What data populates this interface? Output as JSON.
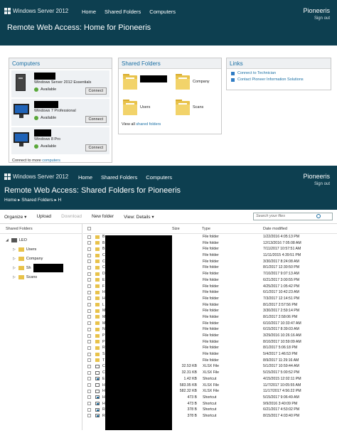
{
  "header1": {
    "logo": "Windows Server 2012",
    "nav": [
      "Home",
      "Shared Folders",
      "Computers"
    ],
    "user": "Pioneeris",
    "signout": "Sign out",
    "title": "Remote Web Access: Home for Pioneeris"
  },
  "computers": {
    "heading": "Computers",
    "items": [
      {
        "os": "Windows Server 2012 Essentials",
        "status": "Available",
        "button": "Connect"
      },
      {
        "os": "Windows 7 Professional",
        "status": "Available",
        "button": "Connect"
      },
      {
        "os": "Windows 8 Pro",
        "status": "Available",
        "button": "Connect"
      }
    ],
    "more_prefix": "Connect to more ",
    "more_link": "computers"
  },
  "shared": {
    "heading": "Shared Folders",
    "folders": [
      "Company",
      "Users",
      "Scans"
    ],
    "viewall_prefix": "View all ",
    "viewall_link": "shared folders"
  },
  "links": {
    "heading": "Links",
    "items": [
      "Connect to Technician",
      "Contact Pioneer Information Solutions"
    ]
  },
  "header2": {
    "logo": "Windows Server 2012",
    "nav": [
      "Home",
      "Shared Folders",
      "Computers"
    ],
    "user": "Pioneeris",
    "signout": "Sign out",
    "title": "Remote Web Access: Shared Folders for Pioneeris",
    "breadcrumb": [
      "Home",
      "Shared Folders",
      "H"
    ]
  },
  "toolbar": {
    "organize": "Organize ▾",
    "upload": "Upload",
    "download": "Download",
    "newfolder": "New folder",
    "view": "View: Details ▾",
    "search_placeholder": "Search your files"
  },
  "tree": {
    "header": "Shared Folders",
    "root": "LEO",
    "nodes": [
      "Users",
      "Company",
      "Sh",
      "Scans"
    ]
  },
  "columns": {
    "size": "Size",
    "type": "Type",
    "date": "Date modified"
  },
  "rows": [
    {
      "name": "B",
      "size": "",
      "type": "File folder",
      "date": "1/22/2016 4:05:13 PM",
      "kind": "folder"
    },
    {
      "name": "B",
      "size": "",
      "type": "File folder",
      "date": "12/13/2016 7:05:08 AM",
      "kind": "folder"
    },
    {
      "name": "B",
      "size": "",
      "type": "File folder",
      "date": "7/11/2017 10:57:51 AM",
      "kind": "folder"
    },
    {
      "name": "C",
      "size": "",
      "type": "File folder",
      "date": "11/11/2015 4:39:51 PM",
      "kind": "folder"
    },
    {
      "name": "C",
      "size": "",
      "type": "File folder",
      "date": "3/30/2017 8:24:08 AM",
      "kind": "folder"
    },
    {
      "name": "C",
      "size": "",
      "type": "File folder",
      "date": "8/1/2017 12:30:50 PM",
      "kind": "folder"
    },
    {
      "name": "D",
      "size": "",
      "type": "File folder",
      "date": "7/10/2017 9:07:13 AM",
      "kind": "folder"
    },
    {
      "name": "E",
      "size": "",
      "type": "File folder",
      "date": "6/21/2017 3:00:55 PM",
      "kind": "folder"
    },
    {
      "name": "F",
      "size": "",
      "type": "File folder",
      "date": "4/25/2017 1:05:42 PM",
      "kind": "folder"
    },
    {
      "name": "H",
      "size": "",
      "type": "File folder",
      "date": "6/1/2017 10:42:23 AM",
      "kind": "folder"
    },
    {
      "name": "H",
      "size": "",
      "type": "File folder",
      "date": "7/3/2017 12:14:51 PM",
      "kind": "folder"
    },
    {
      "name": "L",
      "size": "",
      "type": "File folder",
      "date": "8/1/2017 2:57:56 PM",
      "kind": "folder"
    },
    {
      "name": "M",
      "size": "",
      "type": "File folder",
      "date": "3/30/2017 2:59:14 PM",
      "kind": "folder"
    },
    {
      "name": "M",
      "size": "",
      "type": "File folder",
      "date": "8/1/2017 2:58:06 PM",
      "kind": "folder"
    },
    {
      "name": "M",
      "size": "",
      "type": "File folder",
      "date": "6/10/2017 10:33:47 AM",
      "kind": "folder"
    },
    {
      "name": "N",
      "size": "",
      "type": "File folder",
      "date": "6/15/2017 8:39:03 AM",
      "kind": "folder"
    },
    {
      "name": "P",
      "size": "",
      "type": "File folder",
      "date": "3/29/2016 10:26:16 AM",
      "kind": "folder"
    },
    {
      "name": "P",
      "size": "",
      "type": "File folder",
      "date": "8/10/2017 10:59:09 AM",
      "kind": "folder"
    },
    {
      "name": "R",
      "size": "",
      "type": "File folder",
      "date": "8/1/2017 5:06:18 PM",
      "kind": "folder"
    },
    {
      "name": "S",
      "size": "",
      "type": "File folder",
      "date": "5/4/2017 1:46:53 PM",
      "kind": "folder"
    },
    {
      "name": "T",
      "size": "",
      "type": "File folder",
      "date": "8/9/2017 11:29:16 AM",
      "kind": "folder"
    },
    {
      "name": "C",
      "size": "32.53 KB",
      "type": "XLSX File",
      "date": "5/1/2017 10:59:44 AM",
      "kind": "xlsx"
    },
    {
      "name": "C",
      "size": "32.31 KB",
      "type": "XLSX File",
      "date": "5/15/2017 5:00:52 PM",
      "kind": "xlsx"
    },
    {
      "name": "E",
      "size": "1.42 KB",
      "type": "Shortcut",
      "date": "4/15/2015 12:02:11 PM",
      "kind": "shortcut"
    },
    {
      "name": "H",
      "size": "583.95 KB",
      "type": "XLSX File",
      "date": "11/7/2017 10:05:55 AM",
      "kind": "xlsx"
    },
    {
      "name": "H",
      "size": "582.32 KB",
      "type": "XLSX File",
      "date": "11/17/2017 4:56:22 PM",
      "kind": "xlsx"
    },
    {
      "name": "H",
      "size": "473 B",
      "type": "Shortcut",
      "date": "5/15/2017 9:06:49 AM",
      "kind": "shortcut"
    },
    {
      "name": "H",
      "size": "473 B",
      "type": "Shortcut",
      "date": "9/9/2016 3:40:09 PM",
      "kind": "shortcut"
    },
    {
      "name": "R",
      "size": "378 B",
      "type": "Shortcut",
      "date": "6/21/2017 4:53:02 PM",
      "kind": "shortcut"
    },
    {
      "name": "R",
      "size": "378 B",
      "type": "Shortcut",
      "date": "8/15/2017 4:03:40 PM",
      "kind": "shortcut"
    }
  ]
}
